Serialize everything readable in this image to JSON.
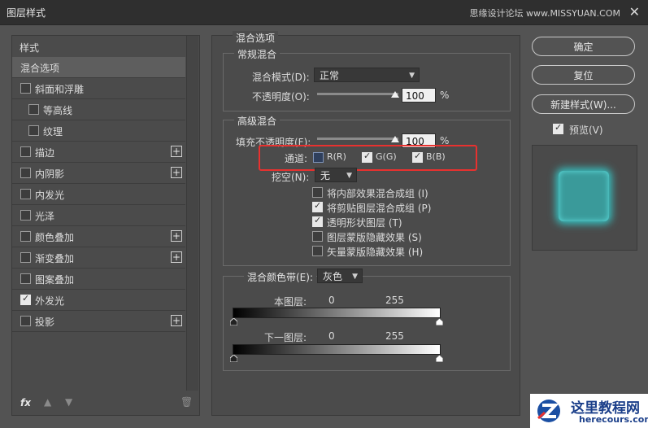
{
  "window": {
    "title": "图层样式",
    "watermark_top": "思缘设计论坛 www.MISSYUAN.COM"
  },
  "left": {
    "header": "样式",
    "items": [
      {
        "label": "混合选项",
        "checked": null,
        "plus": false,
        "selected": true
      },
      {
        "label": "斜面和浮雕",
        "checked": false,
        "plus": false
      },
      {
        "label": "等高线",
        "checked": false,
        "plus": false,
        "indent": true
      },
      {
        "label": "纹理",
        "checked": false,
        "plus": false,
        "indent": true
      },
      {
        "label": "描边",
        "checked": false,
        "plus": true
      },
      {
        "label": "内阴影",
        "checked": false,
        "plus": true
      },
      {
        "label": "内发光",
        "checked": false,
        "plus": false
      },
      {
        "label": "光泽",
        "checked": false,
        "plus": false
      },
      {
        "label": "颜色叠加",
        "checked": false,
        "plus": true
      },
      {
        "label": "渐变叠加",
        "checked": false,
        "plus": true
      },
      {
        "label": "图案叠加",
        "checked": false,
        "plus": false
      },
      {
        "label": "外发光",
        "checked": true,
        "plus": false
      },
      {
        "label": "投影",
        "checked": false,
        "plus": true
      }
    ],
    "fx_label": "fx"
  },
  "blend": {
    "section_title": "混合选项",
    "general": {
      "title": "常规混合",
      "mode_label": "混合模式(D):",
      "mode_value": "正常",
      "opacity_label": "不透明度(O):",
      "opacity_value": "100",
      "percent": "%"
    },
    "advanced": {
      "title": "高级混合",
      "fill_label": "填充不透明度(F):",
      "fill_value": "100",
      "percent": "%",
      "channels_label": "通道:",
      "channel_r": "R(R)",
      "channel_g": "G(G)",
      "channel_b": "B(B)",
      "knockout_label": "挖空(N):",
      "knockout_value": "无",
      "options": [
        {
          "label": "将内部效果混合成组 (I)",
          "checked": false
        },
        {
          "label": "将剪贴图层混合成组 (P)",
          "checked": true
        },
        {
          "label": "透明形状图层 (T)",
          "checked": true
        },
        {
          "label": "图层蒙版隐藏效果 (S)",
          "checked": false
        },
        {
          "label": "矢量蒙版隐藏效果 (H)",
          "checked": false
        }
      ]
    },
    "band": {
      "label": "混合颜色带(E):",
      "value": "灰色",
      "this_layer": "本图层:",
      "under_layer": "下一图层:",
      "min": "0",
      "max": "255"
    }
  },
  "buttons": {
    "ok": "确定",
    "reset": "复位",
    "new_style": "新建样式(W)...",
    "preview": "预览(V)"
  },
  "watermark": {
    "title": "这里教程网",
    "url": "herecours.com"
  },
  "colors": {
    "accent_red": "#e8312f",
    "glow": "#35c7c7"
  }
}
